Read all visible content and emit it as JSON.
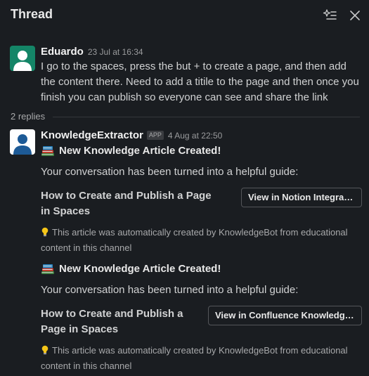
{
  "header": {
    "title": "Thread",
    "filter_icon": "sparkle-filter-icon",
    "close_icon": "close-icon"
  },
  "parent_message": {
    "author": "Eduardo",
    "timestamp": "23 Jul at 16:34",
    "avatar_color": "#148567",
    "text": "I go to the spaces, press the but + to create a page, and then add the content there. Need to add a titile to the page  and then once you finish you can publish so everyone can see and share the link"
  },
  "replies_label": "2 replies",
  "reply": {
    "author": "KnowledgeExtractor",
    "badge": "APP",
    "timestamp": "4 Aug at 22:50",
    "avatar_color": "#1d5a96",
    "articles": [
      {
        "heading": "New Knowledge Article Created!",
        "intro": "Your conversation has been turned into a helpful guide:",
        "title": "How to Create and Publish a Page in Spaces",
        "button": "View in Notion Integration",
        "note": "This article was automatically created by KnowledgeBot from educational content in this channel"
      },
      {
        "heading": "New Knowledge Article Created!",
        "intro": "Your conversation has been turned into a helpful guide:",
        "title": "How to Create and Publish a Page in Spaces",
        "button": "View in Confluence Knowledge b...",
        "note": "This article was automatically created by KnowledgeBot from educational content in this channel"
      }
    ]
  }
}
